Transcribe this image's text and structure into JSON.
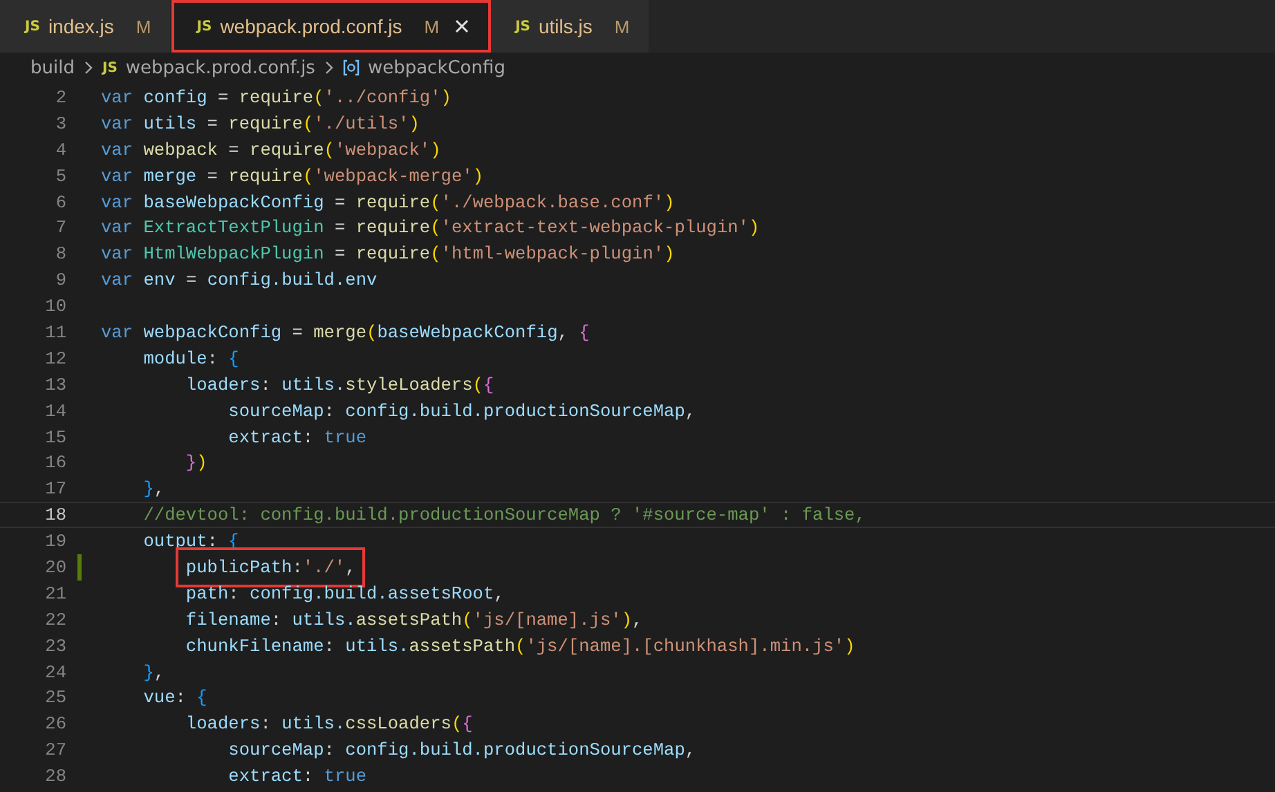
{
  "tabs": [
    {
      "icon": "JS",
      "label": "index.js",
      "badge": "M",
      "selected": false,
      "highlighted": false,
      "closable": false
    },
    {
      "icon": "JS",
      "label": "webpack.prod.conf.js",
      "badge": "M",
      "selected": true,
      "highlighted": true,
      "closable": true
    },
    {
      "icon": "JS",
      "label": "utils.js",
      "badge": "M",
      "selected": false,
      "highlighted": false,
      "closable": false
    }
  ],
  "breadcrumb": {
    "folder": "build",
    "file_icon": "JS",
    "file": "webpack.prod.conf.js",
    "symbol": "webpackConfig"
  },
  "lines": [
    {
      "n": "2",
      "current": false,
      "modified": false,
      "boxed": false,
      "tokens": [
        {
          "kind": "kw",
          "text": "var "
        },
        {
          "kind": "var",
          "text": "config"
        },
        {
          "kind": "p",
          "text": " = "
        },
        {
          "kind": "fn",
          "text": "require"
        },
        {
          "kind": "b1",
          "text": "("
        },
        {
          "kind": "str",
          "text": "'../config'"
        },
        {
          "kind": "b1",
          "text": ")"
        }
      ]
    },
    {
      "n": "3",
      "current": false,
      "modified": false,
      "boxed": false,
      "tokens": [
        {
          "kind": "kw",
          "text": "var "
        },
        {
          "kind": "var",
          "text": "utils"
        },
        {
          "kind": "p",
          "text": " = "
        },
        {
          "kind": "fn",
          "text": "require"
        },
        {
          "kind": "b1",
          "text": "("
        },
        {
          "kind": "str",
          "text": "'./utils'"
        },
        {
          "kind": "b1",
          "text": ")"
        }
      ]
    },
    {
      "n": "4",
      "current": false,
      "modified": false,
      "boxed": false,
      "tokens": [
        {
          "kind": "kw",
          "text": "var "
        },
        {
          "kind": "fn",
          "text": "webpack"
        },
        {
          "kind": "p",
          "text": " = "
        },
        {
          "kind": "fn",
          "text": "require"
        },
        {
          "kind": "b1",
          "text": "("
        },
        {
          "kind": "str",
          "text": "'webpack'"
        },
        {
          "kind": "b1",
          "text": ")"
        }
      ]
    },
    {
      "n": "5",
      "current": false,
      "modified": false,
      "boxed": false,
      "tokens": [
        {
          "kind": "kw",
          "text": "var "
        },
        {
          "kind": "var",
          "text": "merge"
        },
        {
          "kind": "p",
          "text": " = "
        },
        {
          "kind": "fn",
          "text": "require"
        },
        {
          "kind": "b1",
          "text": "("
        },
        {
          "kind": "str",
          "text": "'webpack-merge'"
        },
        {
          "kind": "b1",
          "text": ")"
        }
      ]
    },
    {
      "n": "6",
      "current": false,
      "modified": false,
      "boxed": false,
      "tokens": [
        {
          "kind": "kw",
          "text": "var "
        },
        {
          "kind": "var",
          "text": "baseWebpackConfig"
        },
        {
          "kind": "p",
          "text": " = "
        },
        {
          "kind": "fn",
          "text": "require"
        },
        {
          "kind": "b1",
          "text": "("
        },
        {
          "kind": "str",
          "text": "'./webpack.base.conf'"
        },
        {
          "kind": "b1",
          "text": ")"
        }
      ]
    },
    {
      "n": "7",
      "current": false,
      "modified": false,
      "boxed": false,
      "tokens": [
        {
          "kind": "kw",
          "text": "var "
        },
        {
          "kind": "cls",
          "text": "ExtractTextPlugin"
        },
        {
          "kind": "p",
          "text": " = "
        },
        {
          "kind": "fn",
          "text": "require"
        },
        {
          "kind": "b1",
          "text": "("
        },
        {
          "kind": "str",
          "text": "'extract-text-webpack-plugin'"
        },
        {
          "kind": "b1",
          "text": ")"
        }
      ]
    },
    {
      "n": "8",
      "current": false,
      "modified": false,
      "boxed": false,
      "tokens": [
        {
          "kind": "kw",
          "text": "var "
        },
        {
          "kind": "cls",
          "text": "HtmlWebpackPlugin"
        },
        {
          "kind": "p",
          "text": " = "
        },
        {
          "kind": "fn",
          "text": "require"
        },
        {
          "kind": "b1",
          "text": "("
        },
        {
          "kind": "str",
          "text": "'html-webpack-plugin'"
        },
        {
          "kind": "b1",
          "text": ")"
        }
      ]
    },
    {
      "n": "9",
      "current": false,
      "modified": false,
      "boxed": false,
      "tokens": [
        {
          "kind": "kw",
          "text": "var "
        },
        {
          "kind": "var",
          "text": "env"
        },
        {
          "kind": "p",
          "text": " = "
        },
        {
          "kind": "var",
          "text": "config.build.env"
        }
      ]
    },
    {
      "n": "10",
      "current": false,
      "modified": false,
      "boxed": false
    },
    {
      "n": "11",
      "current": false,
      "modified": false,
      "boxed": false,
      "tokens": [
        {
          "kind": "kw",
          "text": "var "
        },
        {
          "kind": "var",
          "text": "webpackConfig"
        },
        {
          "kind": "p",
          "text": " = "
        },
        {
          "kind": "fn",
          "text": "merge"
        },
        {
          "kind": "b1",
          "text": "("
        },
        {
          "kind": "var",
          "text": "baseWebpackConfig"
        },
        {
          "kind": "p",
          "text": ", "
        },
        {
          "kind": "b2",
          "text": "{"
        }
      ]
    },
    {
      "n": "12",
      "current": false,
      "modified": false,
      "boxed": false,
      "tokens": [
        {
          "kind": "var",
          "text": "    module"
        },
        {
          "kind": "p",
          "text": ": "
        },
        {
          "kind": "b3",
          "text": "{"
        }
      ]
    },
    {
      "n": "13",
      "current": false,
      "modified": false,
      "boxed": false,
      "tokens": [
        {
          "kind": "var",
          "text": "        loaders"
        },
        {
          "kind": "p",
          "text": ": "
        },
        {
          "kind": "var",
          "text": "utils."
        },
        {
          "kind": "fn",
          "text": "styleLoaders"
        },
        {
          "kind": "b1",
          "text": "("
        },
        {
          "kind": "b2",
          "text": "{"
        }
      ]
    },
    {
      "n": "14",
      "current": false,
      "modified": false,
      "boxed": false,
      "tokens": [
        {
          "kind": "var",
          "text": "            sourceMap"
        },
        {
          "kind": "p",
          "text": ": "
        },
        {
          "kind": "var",
          "text": "config.build.productionSourceMap"
        },
        {
          "kind": "p",
          "text": ","
        }
      ]
    },
    {
      "n": "15",
      "current": false,
      "modified": false,
      "boxed": false,
      "tokens": [
        {
          "kind": "var",
          "text": "            extract"
        },
        {
          "kind": "p",
          "text": ": "
        },
        {
          "kind": "kw",
          "text": "true"
        }
      ]
    },
    {
      "n": "16",
      "current": false,
      "modified": false,
      "boxed": false,
      "tokens": [
        {
          "kind": "b2",
          "text": "        }"
        },
        {
          "kind": "b1",
          "text": ")"
        }
      ]
    },
    {
      "n": "17",
      "current": false,
      "modified": false,
      "boxed": false,
      "tokens": [
        {
          "kind": "b3",
          "text": "    }"
        },
        {
          "kind": "p",
          "text": ","
        }
      ]
    },
    {
      "n": "18",
      "current": true,
      "modified": false,
      "boxed": false,
      "tokens": [
        {
          "kind": "cm",
          "text": "    //devtool: config.build.productionSourceMap ? '#source-map' : false,"
        }
      ]
    },
    {
      "n": "19",
      "current": false,
      "modified": false,
      "boxed": false,
      "tokens": [
        {
          "kind": "var",
          "text": "    output"
        },
        {
          "kind": "p",
          "text": ": "
        },
        {
          "kind": "b3",
          "text": "{"
        }
      ]
    },
    {
      "n": "20",
      "current": false,
      "modified": true,
      "boxed": true,
      "tokens": [
        {
          "kind": "var",
          "text": "publicPath"
        },
        {
          "kind": "p",
          "text": ":"
        },
        {
          "kind": "str",
          "text": "'./'"
        },
        {
          "kind": "p",
          "text": ","
        }
      ]
    },
    {
      "n": "21",
      "current": false,
      "modified": false,
      "boxed": false,
      "tokens": [
        {
          "kind": "var",
          "text": "        path"
        },
        {
          "kind": "p",
          "text": ": "
        },
        {
          "kind": "var",
          "text": "config.build.assetsRoot"
        },
        {
          "kind": "p",
          "text": ","
        }
      ]
    },
    {
      "n": "22",
      "current": false,
      "modified": false,
      "boxed": false,
      "tokens": [
        {
          "kind": "var",
          "text": "        filename"
        },
        {
          "kind": "p",
          "text": ": "
        },
        {
          "kind": "var",
          "text": "utils."
        },
        {
          "kind": "fn",
          "text": "assetsPath"
        },
        {
          "kind": "b1",
          "text": "("
        },
        {
          "kind": "str",
          "text": "'js/[name].js'"
        },
        {
          "kind": "b1",
          "text": ")"
        },
        {
          "kind": "p",
          "text": ","
        }
      ]
    },
    {
      "n": "23",
      "current": false,
      "modified": false,
      "boxed": false,
      "tokens": [
        {
          "kind": "var",
          "text": "        chunkFilename"
        },
        {
          "kind": "p",
          "text": ": "
        },
        {
          "kind": "var",
          "text": "utils."
        },
        {
          "kind": "fn",
          "text": "assetsPath"
        },
        {
          "kind": "b1",
          "text": "("
        },
        {
          "kind": "str",
          "text": "'js/[name].[chunkhash].min.js'"
        },
        {
          "kind": "b1",
          "text": ")"
        }
      ]
    },
    {
      "n": "24",
      "current": false,
      "modified": false,
      "boxed": false,
      "tokens": [
        {
          "kind": "b3",
          "text": "    }"
        },
        {
          "kind": "p",
          "text": ","
        }
      ]
    },
    {
      "n": "25",
      "current": false,
      "modified": false,
      "boxed": false,
      "tokens": [
        {
          "kind": "var",
          "text": "    vue"
        },
        {
          "kind": "p",
          "text": ": "
        },
        {
          "kind": "b3",
          "text": "{"
        }
      ]
    },
    {
      "n": "26",
      "current": false,
      "modified": false,
      "boxed": false,
      "tokens": [
        {
          "kind": "var",
          "text": "        loaders"
        },
        {
          "kind": "p",
          "text": ": "
        },
        {
          "kind": "var",
          "text": "utils."
        },
        {
          "kind": "fn",
          "text": "cssLoaders"
        },
        {
          "kind": "b1",
          "text": "("
        },
        {
          "kind": "b2",
          "text": "{"
        }
      ]
    },
    {
      "n": "27",
      "current": false,
      "modified": false,
      "boxed": false,
      "tokens": [
        {
          "kind": "var",
          "text": "            sourceMap"
        },
        {
          "kind": "p",
          "text": ": "
        },
        {
          "kind": "var",
          "text": "config.build.productionSourceMap"
        },
        {
          "kind": "p",
          "text": ","
        }
      ]
    },
    {
      "n": "28",
      "current": false,
      "modified": false,
      "boxed": false,
      "tokens": [
        {
          "kind": "var",
          "text": "            extract"
        },
        {
          "kind": "p",
          "text": ": "
        },
        {
          "kind": "kw",
          "text": "true"
        }
      ]
    }
  ]
}
